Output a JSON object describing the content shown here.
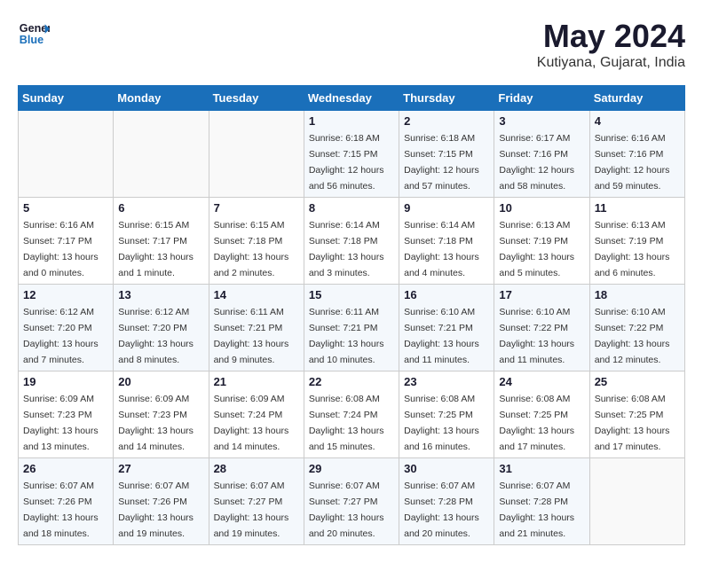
{
  "logo": {
    "general": "General",
    "blue": "Blue"
  },
  "title": "May 2024",
  "subtitle": "Kutiyana, Gujarat, India",
  "weekdays": [
    "Sunday",
    "Monday",
    "Tuesday",
    "Wednesday",
    "Thursday",
    "Friday",
    "Saturday"
  ],
  "weeks": [
    [
      {
        "day": null
      },
      {
        "day": null
      },
      {
        "day": null
      },
      {
        "day": "1",
        "sunrise": "Sunrise: 6:18 AM",
        "sunset": "Sunset: 7:15 PM",
        "daylight": "Daylight: 12 hours and 56 minutes."
      },
      {
        "day": "2",
        "sunrise": "Sunrise: 6:18 AM",
        "sunset": "Sunset: 7:15 PM",
        "daylight": "Daylight: 12 hours and 57 minutes."
      },
      {
        "day": "3",
        "sunrise": "Sunrise: 6:17 AM",
        "sunset": "Sunset: 7:16 PM",
        "daylight": "Daylight: 12 hours and 58 minutes."
      },
      {
        "day": "4",
        "sunrise": "Sunrise: 6:16 AM",
        "sunset": "Sunset: 7:16 PM",
        "daylight": "Daylight: 12 hours and 59 minutes."
      }
    ],
    [
      {
        "day": "5",
        "sunrise": "Sunrise: 6:16 AM",
        "sunset": "Sunset: 7:17 PM",
        "daylight": "Daylight: 13 hours and 0 minutes."
      },
      {
        "day": "6",
        "sunrise": "Sunrise: 6:15 AM",
        "sunset": "Sunset: 7:17 PM",
        "daylight": "Daylight: 13 hours and 1 minute."
      },
      {
        "day": "7",
        "sunrise": "Sunrise: 6:15 AM",
        "sunset": "Sunset: 7:18 PM",
        "daylight": "Daylight: 13 hours and 2 minutes."
      },
      {
        "day": "8",
        "sunrise": "Sunrise: 6:14 AM",
        "sunset": "Sunset: 7:18 PM",
        "daylight": "Daylight: 13 hours and 3 minutes."
      },
      {
        "day": "9",
        "sunrise": "Sunrise: 6:14 AM",
        "sunset": "Sunset: 7:18 PM",
        "daylight": "Daylight: 13 hours and 4 minutes."
      },
      {
        "day": "10",
        "sunrise": "Sunrise: 6:13 AM",
        "sunset": "Sunset: 7:19 PM",
        "daylight": "Daylight: 13 hours and 5 minutes."
      },
      {
        "day": "11",
        "sunrise": "Sunrise: 6:13 AM",
        "sunset": "Sunset: 7:19 PM",
        "daylight": "Daylight: 13 hours and 6 minutes."
      }
    ],
    [
      {
        "day": "12",
        "sunrise": "Sunrise: 6:12 AM",
        "sunset": "Sunset: 7:20 PM",
        "daylight": "Daylight: 13 hours and 7 minutes."
      },
      {
        "day": "13",
        "sunrise": "Sunrise: 6:12 AM",
        "sunset": "Sunset: 7:20 PM",
        "daylight": "Daylight: 13 hours and 8 minutes."
      },
      {
        "day": "14",
        "sunrise": "Sunrise: 6:11 AM",
        "sunset": "Sunset: 7:21 PM",
        "daylight": "Daylight: 13 hours and 9 minutes."
      },
      {
        "day": "15",
        "sunrise": "Sunrise: 6:11 AM",
        "sunset": "Sunset: 7:21 PM",
        "daylight": "Daylight: 13 hours and 10 minutes."
      },
      {
        "day": "16",
        "sunrise": "Sunrise: 6:10 AM",
        "sunset": "Sunset: 7:21 PM",
        "daylight": "Daylight: 13 hours and 11 minutes."
      },
      {
        "day": "17",
        "sunrise": "Sunrise: 6:10 AM",
        "sunset": "Sunset: 7:22 PM",
        "daylight": "Daylight: 13 hours and 11 minutes."
      },
      {
        "day": "18",
        "sunrise": "Sunrise: 6:10 AM",
        "sunset": "Sunset: 7:22 PM",
        "daylight": "Daylight: 13 hours and 12 minutes."
      }
    ],
    [
      {
        "day": "19",
        "sunrise": "Sunrise: 6:09 AM",
        "sunset": "Sunset: 7:23 PM",
        "daylight": "Daylight: 13 hours and 13 minutes."
      },
      {
        "day": "20",
        "sunrise": "Sunrise: 6:09 AM",
        "sunset": "Sunset: 7:23 PM",
        "daylight": "Daylight: 13 hours and 14 minutes."
      },
      {
        "day": "21",
        "sunrise": "Sunrise: 6:09 AM",
        "sunset": "Sunset: 7:24 PM",
        "daylight": "Daylight: 13 hours and 14 minutes."
      },
      {
        "day": "22",
        "sunrise": "Sunrise: 6:08 AM",
        "sunset": "Sunset: 7:24 PM",
        "daylight": "Daylight: 13 hours and 15 minutes."
      },
      {
        "day": "23",
        "sunrise": "Sunrise: 6:08 AM",
        "sunset": "Sunset: 7:25 PM",
        "daylight": "Daylight: 13 hours and 16 minutes."
      },
      {
        "day": "24",
        "sunrise": "Sunrise: 6:08 AM",
        "sunset": "Sunset: 7:25 PM",
        "daylight": "Daylight: 13 hours and 17 minutes."
      },
      {
        "day": "25",
        "sunrise": "Sunrise: 6:08 AM",
        "sunset": "Sunset: 7:25 PM",
        "daylight": "Daylight: 13 hours and 17 minutes."
      }
    ],
    [
      {
        "day": "26",
        "sunrise": "Sunrise: 6:07 AM",
        "sunset": "Sunset: 7:26 PM",
        "daylight": "Daylight: 13 hours and 18 minutes."
      },
      {
        "day": "27",
        "sunrise": "Sunrise: 6:07 AM",
        "sunset": "Sunset: 7:26 PM",
        "daylight": "Daylight: 13 hours and 19 minutes."
      },
      {
        "day": "28",
        "sunrise": "Sunrise: 6:07 AM",
        "sunset": "Sunset: 7:27 PM",
        "daylight": "Daylight: 13 hours and 19 minutes."
      },
      {
        "day": "29",
        "sunrise": "Sunrise: 6:07 AM",
        "sunset": "Sunset: 7:27 PM",
        "daylight": "Daylight: 13 hours and 20 minutes."
      },
      {
        "day": "30",
        "sunrise": "Sunrise: 6:07 AM",
        "sunset": "Sunset: 7:28 PM",
        "daylight": "Daylight: 13 hours and 20 minutes."
      },
      {
        "day": "31",
        "sunrise": "Sunrise: 6:07 AM",
        "sunset": "Sunset: 7:28 PM",
        "daylight": "Daylight: 13 hours and 21 minutes."
      },
      {
        "day": null
      }
    ]
  ]
}
